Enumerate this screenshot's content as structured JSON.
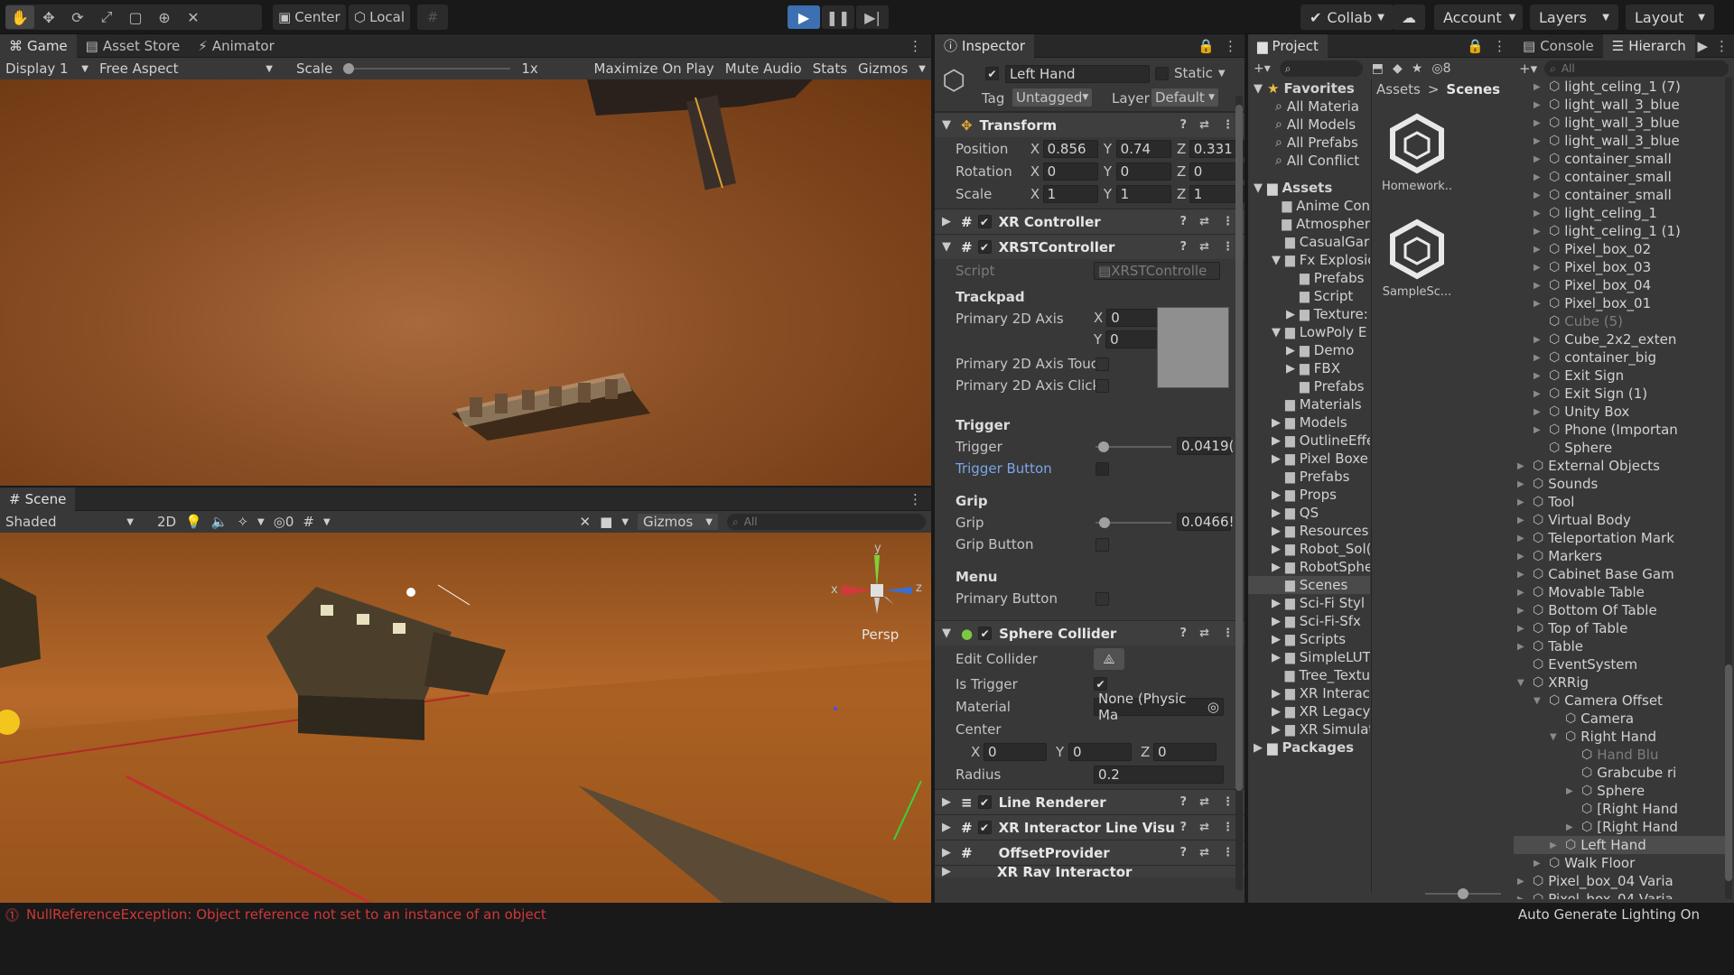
{
  "toolbar": {
    "center_label": "Center",
    "local_label": "Local",
    "collab_label": "Collab",
    "account_label": "Account",
    "layers_label": "Layers",
    "layout_label": "Layout"
  },
  "game_view": {
    "tabs": [
      "Game",
      "Asset Store",
      "Animator"
    ],
    "display": "Display 1",
    "aspect": "Free Aspect",
    "scale_label": "Scale",
    "scale_value": "1x",
    "maximize": "Maximize On Play",
    "mute": "Mute Audio",
    "stats": "Stats",
    "gizmos": "Gizmos"
  },
  "scene_view": {
    "tab": "Scene",
    "shading": "Shaded",
    "mode_2d": "2D",
    "hidden_count": "0",
    "gizmos": "Gizmos",
    "search_placeholder": "All",
    "persp": "Persp",
    "axis_y": "y",
    "axis_x": "x",
    "axis_z": "z"
  },
  "inspector": {
    "tab": "Inspector",
    "object_name": "Left Hand",
    "static_label": "Static",
    "tag_label": "Tag",
    "tag_value": "Untagged",
    "layer_label": "Layer",
    "layer_value": "Default",
    "transform": {
      "title": "Transform",
      "position_label": "Position",
      "px": "0.856",
      "py": "0.74",
      "pz": "0.331",
      "rotation_label": "Rotation",
      "rx": "0",
      "ry": "0",
      "rz": "0",
      "scale_label": "Scale",
      "sx": "1",
      "sy": "1",
      "sz": "1"
    },
    "xr_controller": "XR Controller",
    "xrst": {
      "title": "XRSTController",
      "script_label": "Script",
      "script_value": "XRSTControlle",
      "trackpad": "Trackpad",
      "primary_axis": "Primary 2D Axis",
      "axis_x": "0",
      "axis_y": "0",
      "axis_touch": "Primary 2D Axis Touc",
      "axis_click": "Primary 2D Axis Click",
      "trigger_header": "Trigger",
      "trigger_label": "Trigger",
      "trigger_value": "0.0419(",
      "trigger_fraction": 0.04,
      "trigger_button": "Trigger Button",
      "grip_header": "Grip",
      "grip_label": "Grip",
      "grip_value": "0.0466!",
      "grip_fraction": 0.05,
      "grip_button": "Grip Button",
      "menu_header": "Menu",
      "primary_button": "Primary Button"
    },
    "sphere_collider": {
      "title": "Sphere Collider",
      "edit_collider": "Edit Collider",
      "is_trigger": "Is Trigger",
      "material_label": "Material",
      "material_value": "None (Physic Ma",
      "center_label": "Center",
      "cx": "0",
      "cy": "0",
      "cz": "0",
      "radius_label": "Radius",
      "radius_value": "0.2"
    },
    "line_renderer": "Line Renderer",
    "xr_line_visual": "XR Interactor Line Visu",
    "offset_provider": "OffsetProvider",
    "xr_ray_interactor": "XR Ray Interactor"
  },
  "project": {
    "tab": "Project",
    "count": "8",
    "breadcrumb_root": "Assets",
    "breadcrumb_leaf": "Scenes",
    "favorites_label": "Favorites",
    "favorites": [
      "All Materia",
      "All Models",
      "All Prefabs",
      "All Conflict"
    ],
    "assets_label": "Assets",
    "folders": [
      {
        "name": "Anime Con",
        "depth": 1,
        "fold": ""
      },
      {
        "name": "Atmospher",
        "depth": 1,
        "fold": ""
      },
      {
        "name": "CasualGar",
        "depth": 1,
        "fold": ""
      },
      {
        "name": "Fx Explosic",
        "depth": 1,
        "fold": "open"
      },
      {
        "name": "Prefabs",
        "depth": 2,
        "fold": ""
      },
      {
        "name": "Script",
        "depth": 2,
        "fold": ""
      },
      {
        "name": "Texture:",
        "depth": 2,
        "fold": "closed"
      },
      {
        "name": "LowPoly E",
        "depth": 1,
        "fold": "open"
      },
      {
        "name": "Demo",
        "depth": 2,
        "fold": "closed"
      },
      {
        "name": "FBX",
        "depth": 2,
        "fold": "closed"
      },
      {
        "name": "Prefabs",
        "depth": 2,
        "fold": ""
      },
      {
        "name": "Materials",
        "depth": 1,
        "fold": ""
      },
      {
        "name": "Models",
        "depth": 1,
        "fold": "closed"
      },
      {
        "name": "OutlineEffe",
        "depth": 1,
        "fold": "closed"
      },
      {
        "name": "Pixel Boxe",
        "depth": 1,
        "fold": "closed"
      },
      {
        "name": "Prefabs",
        "depth": 1,
        "fold": ""
      },
      {
        "name": "Props",
        "depth": 1,
        "fold": "closed"
      },
      {
        "name": "QS",
        "depth": 1,
        "fold": "closed"
      },
      {
        "name": "Resources",
        "depth": 1,
        "fold": "closed"
      },
      {
        "name": "Robot_Sol(",
        "depth": 1,
        "fold": "closed"
      },
      {
        "name": "RobotSphe",
        "depth": 1,
        "fold": "closed"
      },
      {
        "name": "Scenes",
        "depth": 1,
        "fold": "",
        "selected": true
      },
      {
        "name": "Sci-Fi Styl",
        "depth": 1,
        "fold": "closed"
      },
      {
        "name": "Sci-Fi-Sfx",
        "depth": 1,
        "fold": "closed"
      },
      {
        "name": "Scripts",
        "depth": 1,
        "fold": "closed"
      },
      {
        "name": "SimpleLUT",
        "depth": 1,
        "fold": "closed"
      },
      {
        "name": "Tree_Textu",
        "depth": 1,
        "fold": ""
      },
      {
        "name": "XR Interac",
        "depth": 1,
        "fold": "closed"
      },
      {
        "name": "XR Legacy",
        "depth": 1,
        "fold": "closed"
      },
      {
        "name": "XR Simulat",
        "depth": 1,
        "fold": "closed"
      }
    ],
    "packages_label": "Packages",
    "grid": [
      {
        "name": "Homework.."
      },
      {
        "name": "SampleSc..."
      }
    ]
  },
  "hierarchy": {
    "console_tab": "Console",
    "tab": "Hierarch",
    "search_placeholder": "All",
    "items": [
      {
        "name": "light_celing_1 (7)",
        "depth": 1,
        "fold": "closed"
      },
      {
        "name": "light_wall_3_blue",
        "depth": 1,
        "fold": "closed"
      },
      {
        "name": "light_wall_3_blue",
        "depth": 1,
        "fold": "closed"
      },
      {
        "name": "light_wall_3_blue",
        "depth": 1,
        "fold": "closed"
      },
      {
        "name": "container_small",
        "depth": 1,
        "fold": "closed"
      },
      {
        "name": "container_small",
        "depth": 1,
        "fold": "closed"
      },
      {
        "name": "container_small",
        "depth": 1,
        "fold": "closed"
      },
      {
        "name": "light_celing_1",
        "depth": 1,
        "fold": "closed"
      },
      {
        "name": "light_celing_1 (1)",
        "depth": 1,
        "fold": "closed"
      },
      {
        "name": "Pixel_box_02",
        "depth": 1,
        "fold": "closed"
      },
      {
        "name": "Pixel_box_03",
        "depth": 1,
        "fold": "closed"
      },
      {
        "name": "Pixel_box_04",
        "depth": 1,
        "fold": "closed"
      },
      {
        "name": "Pixel_box_01",
        "depth": 1,
        "fold": "closed"
      },
      {
        "name": "Cube (5)",
        "depth": 1,
        "fold": "",
        "dim": true
      },
      {
        "name": "Cube_2x2_exten",
        "depth": 1,
        "fold": "closed"
      },
      {
        "name": "container_big",
        "depth": 1,
        "fold": "closed"
      },
      {
        "name": "Exit Sign",
        "depth": 1,
        "fold": "closed"
      },
      {
        "name": "Exit Sign (1)",
        "depth": 1,
        "fold": "closed"
      },
      {
        "name": "Unity Box",
        "depth": 1,
        "fold": "closed"
      },
      {
        "name": "Phone (Importan",
        "depth": 1,
        "fold": "closed"
      },
      {
        "name": "Sphere",
        "depth": 1,
        "fold": ""
      },
      {
        "name": "External Objects",
        "depth": 0,
        "fold": "closed"
      },
      {
        "name": "Sounds",
        "depth": 0,
        "fold": "closed"
      },
      {
        "name": "Tool",
        "depth": 0,
        "fold": "closed"
      },
      {
        "name": "Virtual Body",
        "depth": 0,
        "fold": "closed"
      },
      {
        "name": "Teleportation Mark",
        "depth": 0,
        "fold": "closed"
      },
      {
        "name": "Markers",
        "depth": 0,
        "fold": "closed"
      },
      {
        "name": "Cabinet Base Gam",
        "depth": 0,
        "fold": "closed"
      },
      {
        "name": "Movable Table",
        "depth": 0,
        "fold": "closed"
      },
      {
        "name": "Bottom Of Table",
        "depth": 0,
        "fold": "closed"
      },
      {
        "name": "Top of Table",
        "depth": 0,
        "fold": "closed"
      },
      {
        "name": "Table",
        "depth": 0,
        "fold": "closed"
      },
      {
        "name": "EventSystem",
        "depth": 0,
        "fold": ""
      },
      {
        "name": "XRRig",
        "depth": 0,
        "fold": "open"
      },
      {
        "name": "Camera Offset",
        "depth": 1,
        "fold": "open"
      },
      {
        "name": "Camera",
        "depth": 2,
        "fold": ""
      },
      {
        "name": "Right Hand",
        "depth": 2,
        "fold": "open"
      },
      {
        "name": "Hand Blu",
        "depth": 3,
        "fold": "",
        "dim": true
      },
      {
        "name": "Grabcube ri",
        "depth": 3,
        "fold": ""
      },
      {
        "name": "Sphere",
        "depth": 3,
        "fold": "closed"
      },
      {
        "name": "[Right Hand",
        "depth": 3,
        "fold": ""
      },
      {
        "name": "[Right Hand",
        "depth": 3,
        "fold": "closed"
      },
      {
        "name": "Left Hand",
        "depth": 2,
        "fold": "closed",
        "selected": true
      },
      {
        "name": "Walk Floor",
        "depth": 1,
        "fold": "closed"
      },
      {
        "name": "Pixel_box_04 Varia",
        "depth": 0,
        "fold": "closed"
      },
      {
        "name": "Pixel_box_04 Varia",
        "depth": 0,
        "fold": "closed"
      }
    ]
  },
  "status": {
    "error": "NullReferenceException: Object reference not set to an instance of an object",
    "lighting": "Auto Generate Lighting On"
  }
}
